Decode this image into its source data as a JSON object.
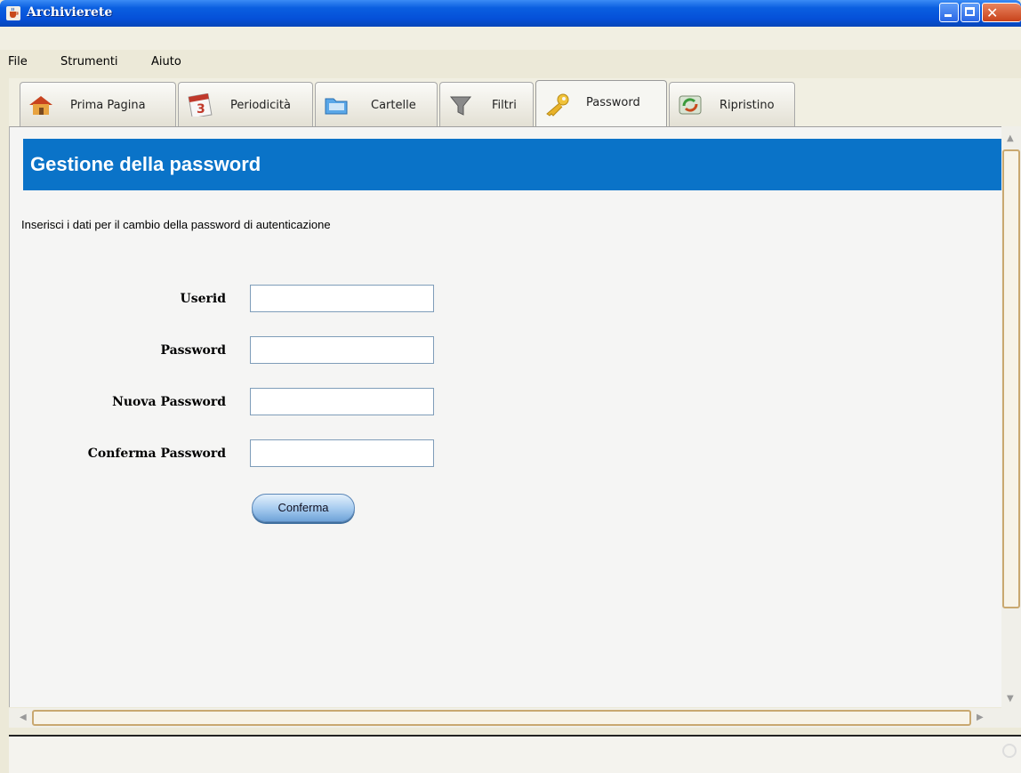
{
  "window": {
    "title": "Archivierete"
  },
  "menu": {
    "items": [
      {
        "label": "File"
      },
      {
        "label": "Strumenti"
      },
      {
        "label": "Aiuto"
      }
    ]
  },
  "tabs": [
    {
      "label": "Prima Pagina",
      "icon": "home-icon",
      "active": false
    },
    {
      "label": "Periodicità",
      "icon": "calendar-icon",
      "active": false
    },
    {
      "label": "Cartelle",
      "icon": "folder-icon",
      "active": false
    },
    {
      "label": "Filtri",
      "icon": "filter-icon",
      "active": false
    },
    {
      "label": "Password",
      "icon": "key-icon",
      "active": true
    },
    {
      "label": "Ripristino",
      "icon": "restore-icon",
      "active": false
    }
  ],
  "panel": {
    "title": "Gestione della password",
    "instructions": "Inserisci i dati per il cambio della password di autenticazione",
    "fields": [
      {
        "label": "Userid",
        "value": ""
      },
      {
        "label": "Password",
        "value": ""
      },
      {
        "label": "Nuova Password",
        "value": ""
      },
      {
        "label": "Conferma Password",
        "value": ""
      }
    ],
    "confirm_label": "Conferma"
  },
  "colors": {
    "header_band": "#0a73c8",
    "titlebar": "#0550d8"
  }
}
